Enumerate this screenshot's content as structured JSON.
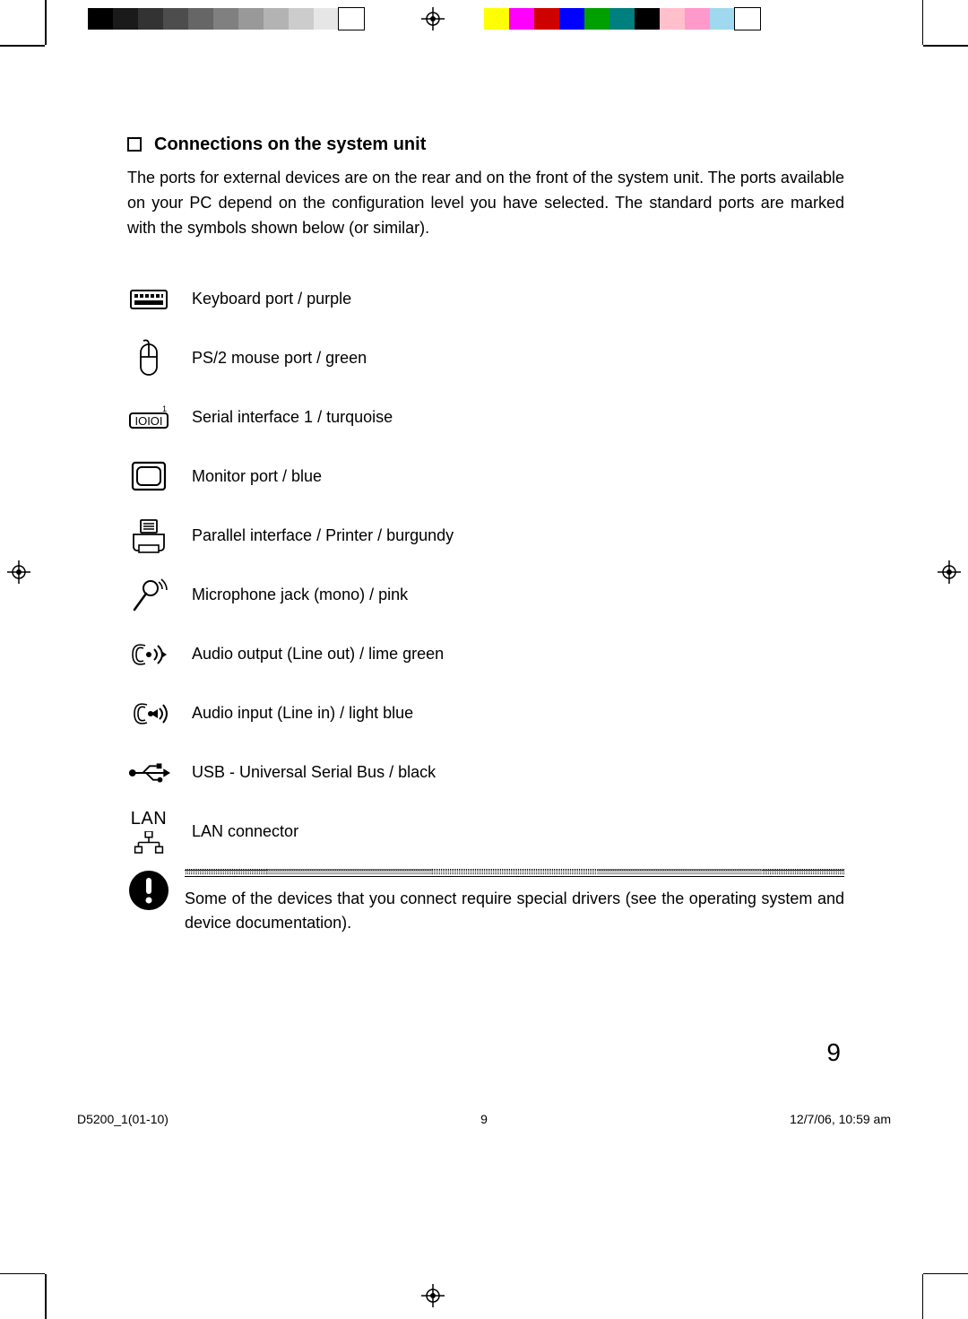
{
  "heading": "Connections on the system unit",
  "intro": "The ports for external devices are on the rear and on the front of the system unit. The ports available on your PC depend on the configuration level you have selected. The standard ports are marked with the symbols shown below (or similar).",
  "ports": [
    {
      "icon": "keyboard-icon",
      "label": "Keyboard port / purple"
    },
    {
      "icon": "mouse-icon",
      "label": "PS/2 mouse port / green"
    },
    {
      "icon": "serial-icon",
      "label": "Serial interface 1 / turquoise"
    },
    {
      "icon": "monitor-icon",
      "label": "Monitor port / blue"
    },
    {
      "icon": "printer-icon",
      "label": "Parallel interface / Printer / burgundy"
    },
    {
      "icon": "microphone-icon",
      "label": "Microphone jack (mono) / pink"
    },
    {
      "icon": "line-out-icon",
      "label": "Audio output (Line out) / lime green"
    },
    {
      "icon": "line-in-icon",
      "label": "Audio input (Line in) / light blue"
    },
    {
      "icon": "usb-icon",
      "label": "USB - Universal Serial Bus / black"
    },
    {
      "icon": "lan-icon",
      "label": "LAN connector"
    }
  ],
  "lanCaption": "LAN",
  "note": "Some of the devices that you connect require special drivers (see the operating system and device documentation).",
  "pageNumber": "9",
  "footer": {
    "left": "D5200_1(01-10)",
    "center": "9",
    "right": "12/7/06, 10:59 am"
  },
  "grayBar": [
    "#000000",
    "#1a1a1a",
    "#333333",
    "#4d4d4d",
    "#666666",
    "#808080",
    "#999999",
    "#b3b3b3",
    "#cccccc",
    "#e6e6e6",
    "#ffffff"
  ],
  "colorBar": [
    "#ffff00",
    "#ff00ff",
    "#ce0000",
    "#0000ff",
    "#00a000",
    "#007f7f",
    "#000000",
    "#ffc0cb",
    "#ff99cc",
    "#a0d8f0",
    "#ffffff"
  ]
}
